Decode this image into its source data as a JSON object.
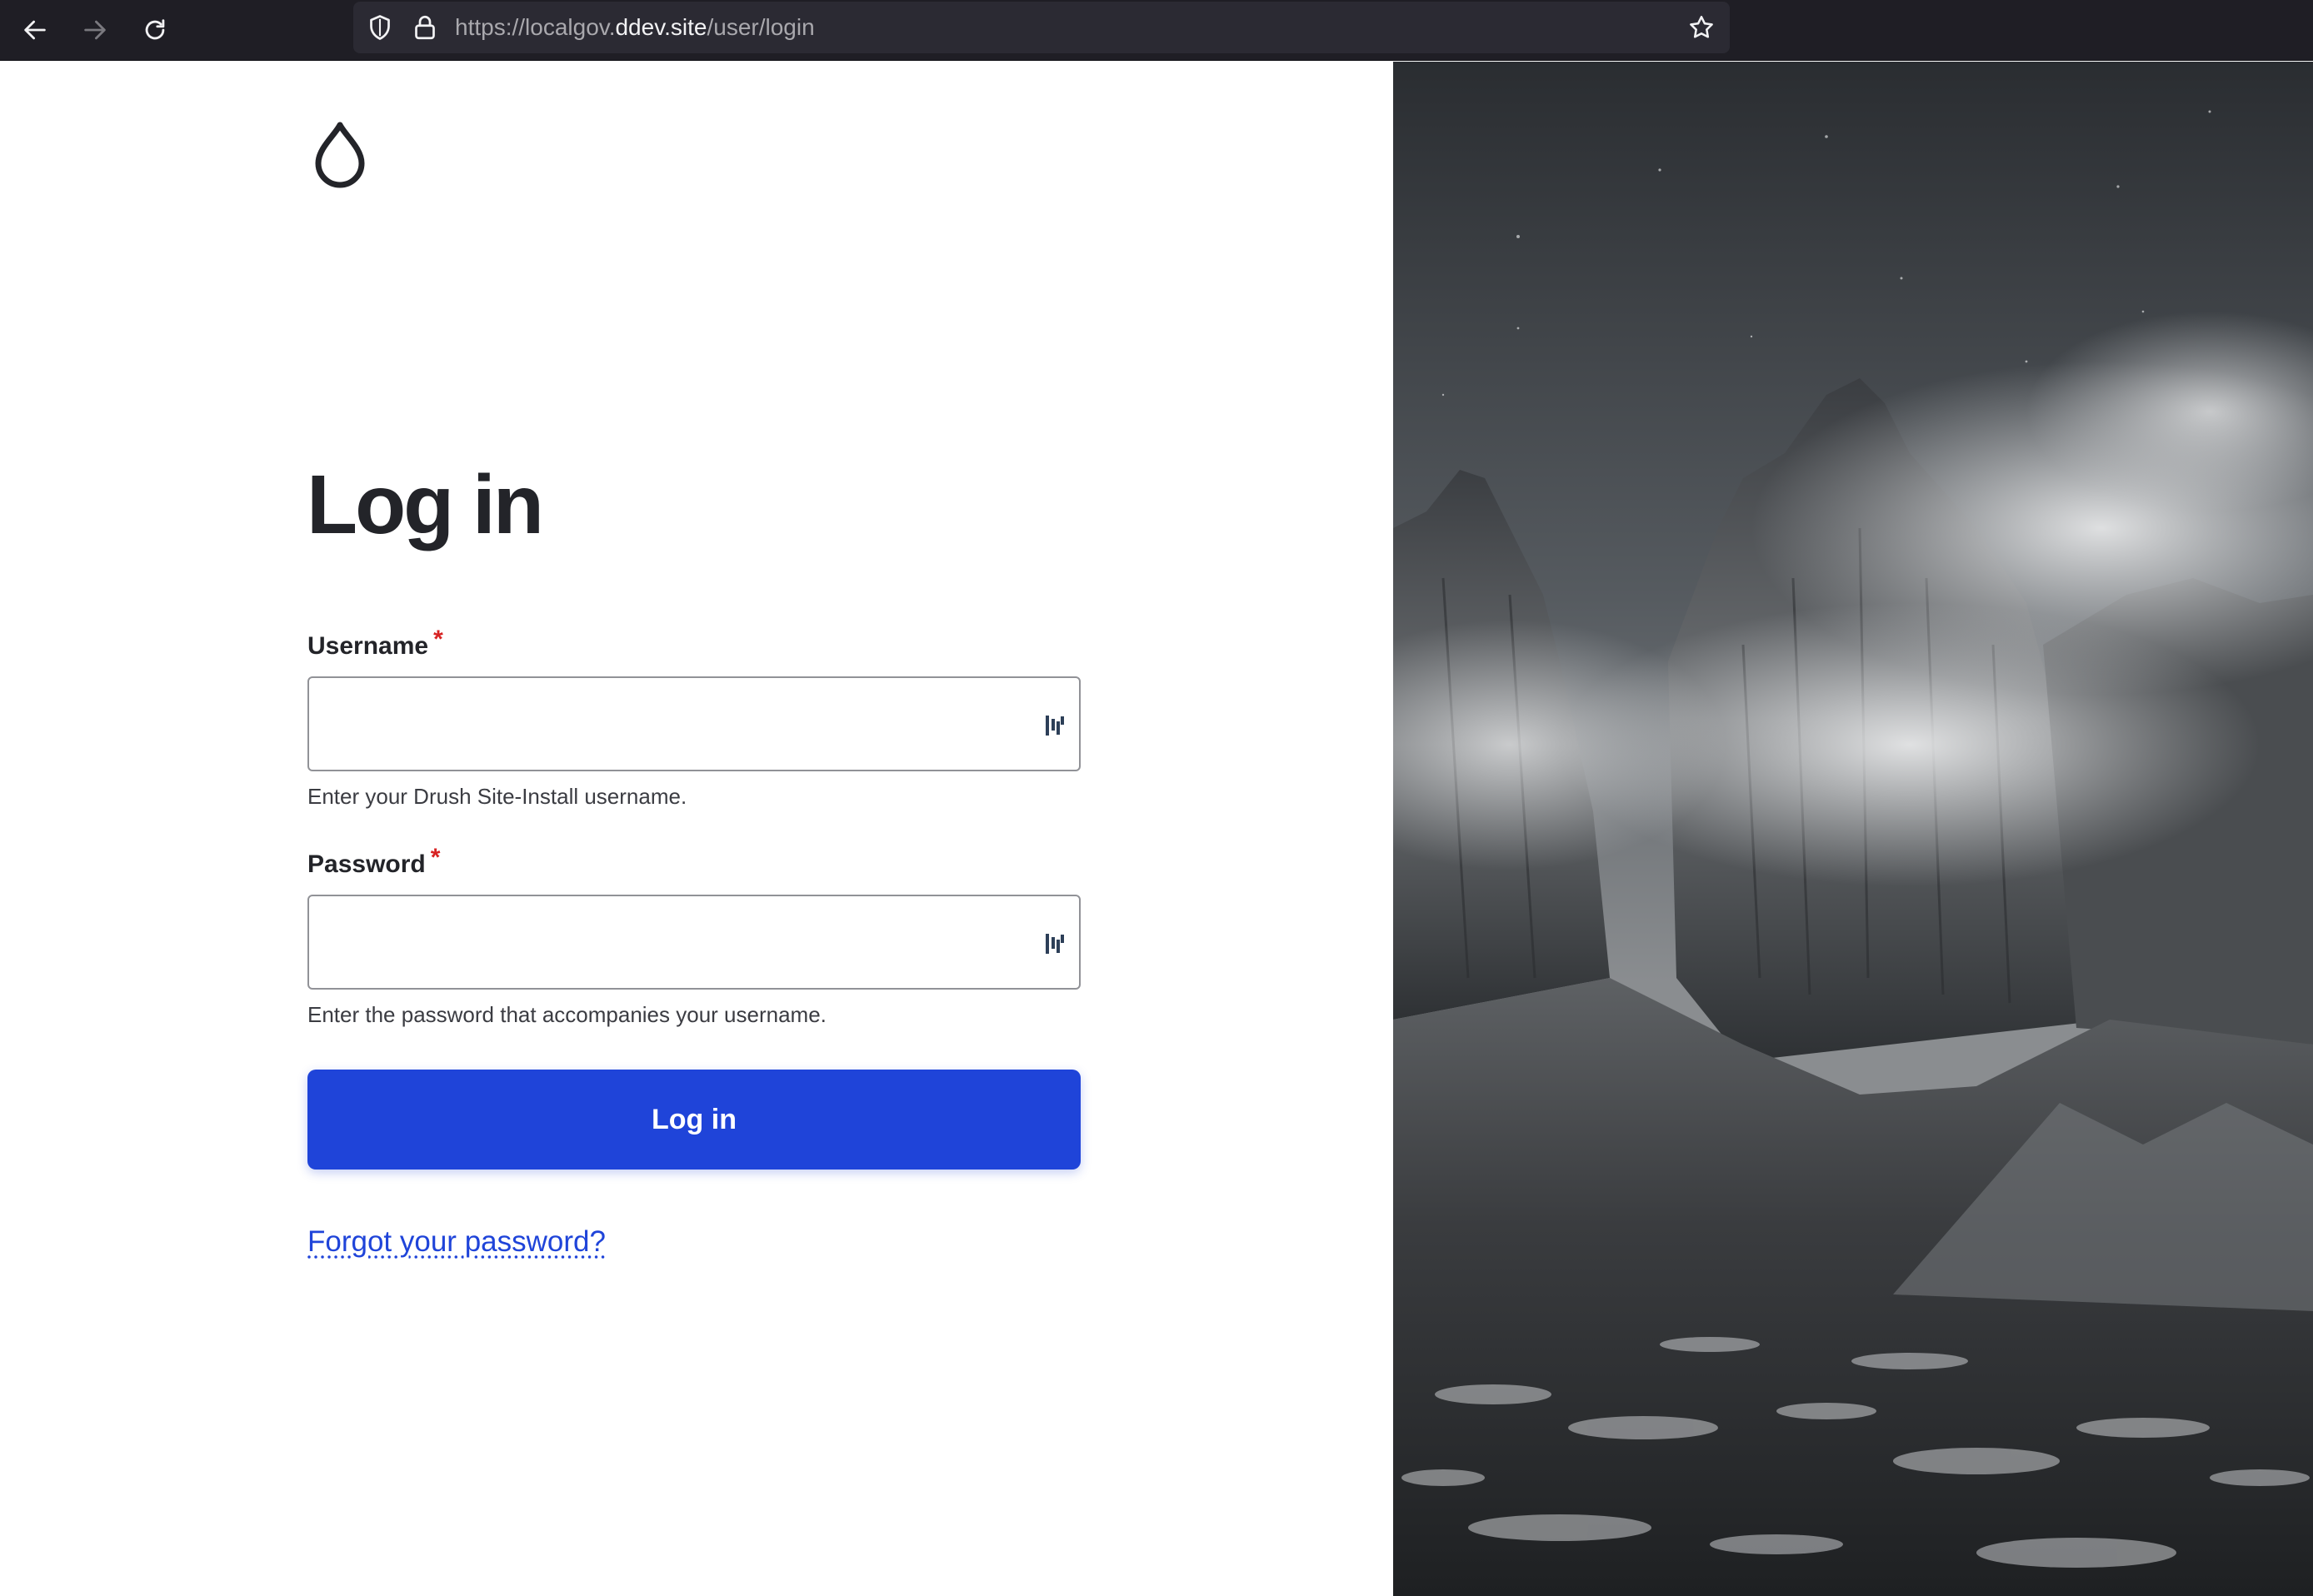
{
  "browser": {
    "url_prefix": "https://localgov.",
    "url_host": "ddev.site",
    "url_path": "/user/login",
    "icons": [
      "back-arrow-icon",
      "forward-arrow-icon",
      "reload-icon",
      "shield-icon",
      "lock-icon",
      "star-icon"
    ]
  },
  "login": {
    "title": "Log in",
    "username": {
      "label": "Username",
      "required_marker": "*",
      "value": "",
      "description": "Enter your Drush Site-Install username."
    },
    "password": {
      "label": "Password",
      "required_marker": "*",
      "value": "",
      "description": "Enter the password that accompanies your username."
    },
    "submit_label": "Log in",
    "forgot_link": "Forgot your password?"
  },
  "colors": {
    "accent": "#1f44d9",
    "required": "#d72222",
    "text": "#232429",
    "chrome_bg": "#1f1e25"
  }
}
